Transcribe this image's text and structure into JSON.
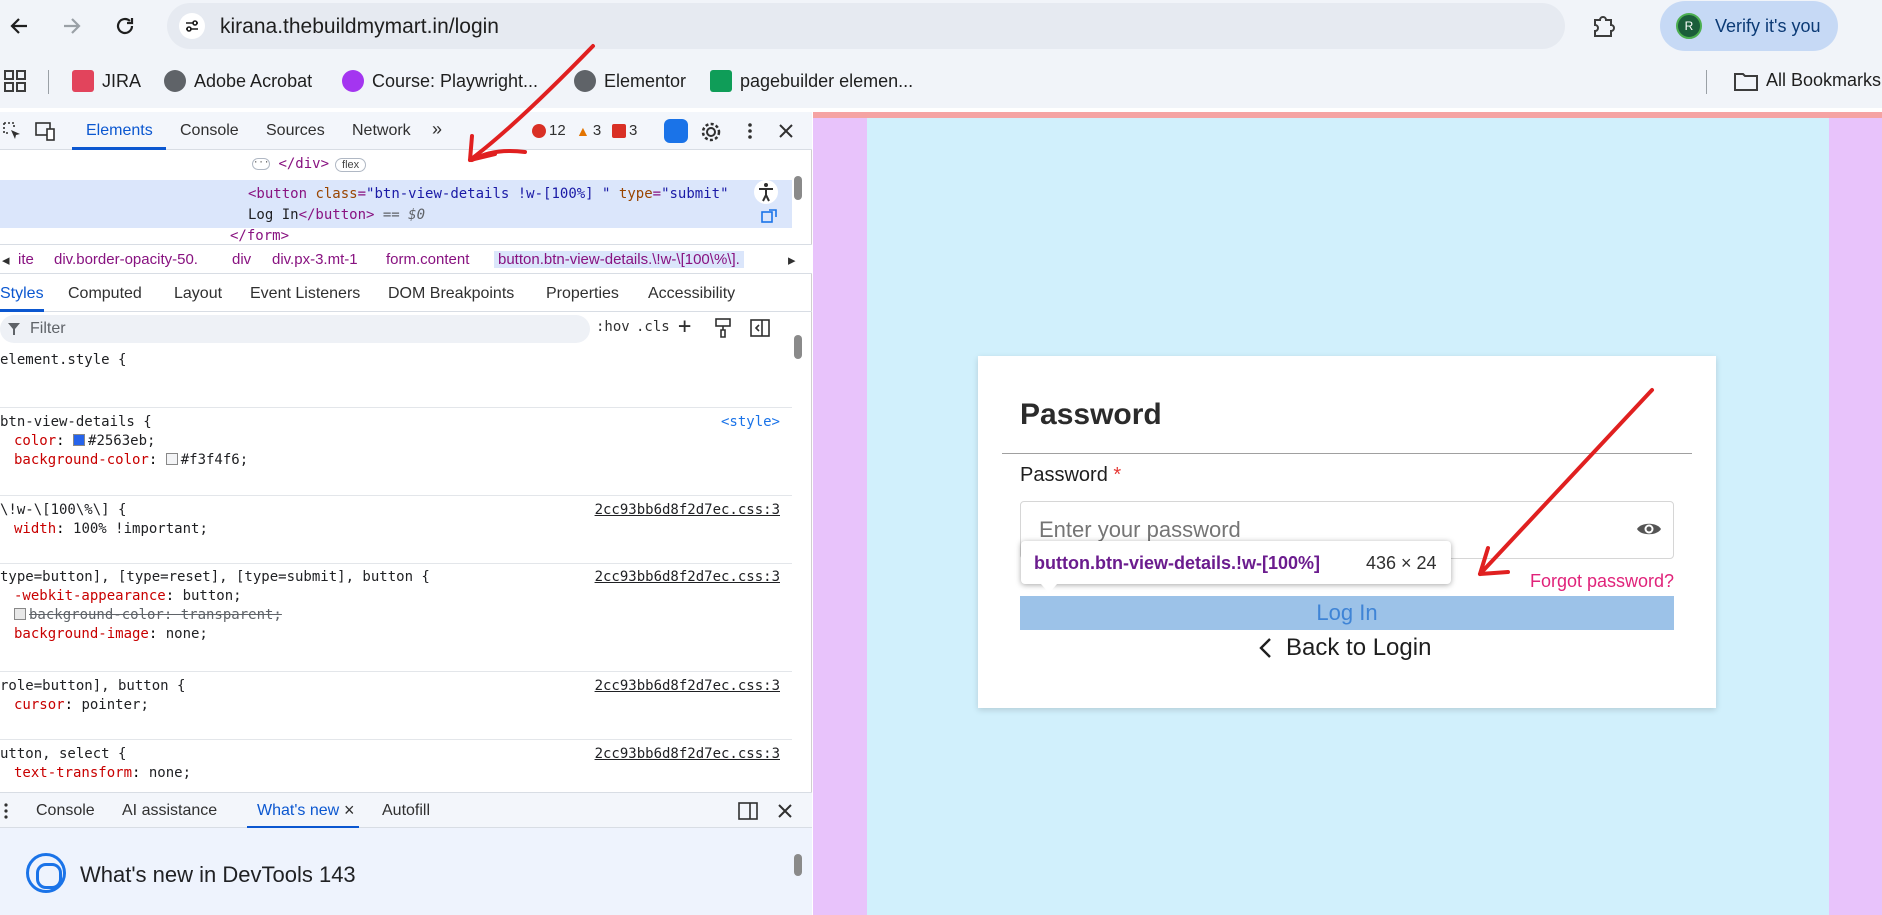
{
  "browser": {
    "url": "kirana.thebuildmymart.in/login",
    "verify_label": "Verify it's you",
    "avatar_initial": "R",
    "bookmarks": [
      {
        "label": "JIRA",
        "color": "#e2445c"
      },
      {
        "label": "Adobe Acrobat",
        "color": "#5f6368"
      },
      {
        "label": "Course: Playwright...",
        "color": "#a435f0"
      },
      {
        "label": "Elementor",
        "color": "#5f6368"
      },
      {
        "label": "pagebuilder elemen...",
        "color": "#0f9d58"
      }
    ],
    "all_bookmarks": "All Bookmarks"
  },
  "devtools": {
    "tabs": [
      "Elements",
      "Console",
      "Sources",
      "Network"
    ],
    "more_tabs": "»",
    "errors": "12",
    "warnings": "3",
    "issues": "3",
    "dom": {
      "line1_tag": "</div>",
      "line1_pill": "flex",
      "line2_open": "<button ",
      "line2_attr_class": "class",
      "line2_class_val": "\"btn-view-details !w-[100%] \"",
      "line2_attr_type": "type",
      "line2_type_val": "\"submit\"",
      "line3_text": "Log In",
      "line3_close": "</button>",
      "line3_eq": " == $0",
      "line4_tag": "</form>"
    },
    "breadcrumbs": [
      "ite",
      "div.border-opacity-50.",
      "div",
      "div.px-3.mt-1",
      "form.content",
      "button.btn-view-details.\\!w-\\[100\\%\\]."
    ],
    "subtabs": [
      "Styles",
      "Computed",
      "Layout",
      "Event Listeners",
      "DOM Breakpoints",
      "Properties",
      "Accessibility"
    ],
    "filter_placeholder": "Filter",
    "filter_hov": ":hov",
    "filter_cls": ".cls",
    "styles": {
      "r1_sel": "element.style {",
      "r2_sel": "btn-view-details {",
      "r2_src": "<style>",
      "r2_p1n": "color",
      "r2_p1v": "#2563eb;",
      "r2_p2n": "background-color",
      "r2_p2v": "#f3f4f6;",
      "r3_sel": "\\!w-\\[100\\%\\] {",
      "r3_src": "2cc93bb6d8f2d7ec.css:3",
      "r3_p1n": "width",
      "r3_p1v": "100% !important;",
      "r4_sel": "type=button], [type=reset], [type=submit], button {",
      "r4_src": "2cc93bb6d8f2d7ec.css:3",
      "r4_p1n": "-webkit-appearance",
      "r4_p1v": "button;",
      "r4_p2": "background-color: transparent;",
      "r4_p3n": "background-image",
      "r4_p3v": "none;",
      "r5_sel": "role=button], button {",
      "r5_src": "2cc93bb6d8f2d7ec.css:3",
      "r5_p1n": "cursor",
      "r5_p1v": "pointer;",
      "r6_sel": "utton, select {",
      "r6_src": "2cc93bb6d8f2d7ec.css:3",
      "r6_p1n": "text-transform",
      "r6_p1v": "none;"
    },
    "drawer_tabs": [
      "Console",
      "AI assistance",
      "What's new",
      "Autofill"
    ],
    "whats_new_title": "What's new in DevTools 143"
  },
  "page": {
    "title": "Password",
    "password_label": "Password",
    "required_mark": "*",
    "password_placeholder": "Enter your password",
    "forgot_link": "Forgot password?",
    "login_button": "Log In",
    "back_link": "Back to Login",
    "tooltip_selector": "button.btn-view-details.!w-[100%]",
    "tooltip_size": "436 × 24"
  },
  "colors": {
    "accent": "#0b57d0",
    "page_outer": "#e8c3fb",
    "page_inner": "#d1f0fc",
    "login_button_bg": "#9cc2e8",
    "annotation_arrow": "#e02020"
  }
}
